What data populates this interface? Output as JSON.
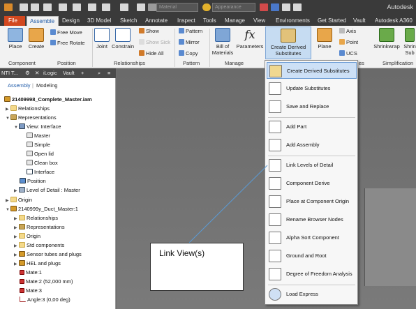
{
  "app": {
    "title": "Autodesk"
  },
  "qat": {
    "material": "Material",
    "appearance": "Appearance"
  },
  "tabs": [
    "File",
    "Assemble",
    "Design",
    "3D Model",
    "Sketch",
    "Annotate",
    "Inspect",
    "Tools",
    "Manage",
    "View",
    "Environments",
    "Get Started",
    "Vault",
    "Autodesk A360"
  ],
  "ribbon": {
    "place": "Place",
    "create": "Create",
    "free_move": "Free Move",
    "free_rotate": "Free Rotate",
    "joint": "Joint",
    "constrain": "Constrain",
    "show": "Show",
    "show_sick": "Show Sick",
    "hide_all": "Hide All",
    "pattern": "Pattern",
    "mirror": "Mirror",
    "copy": "Copy",
    "bom_line1": "Bill of",
    "bom_line2": "Materials",
    "parameters": "Parameters",
    "cds_line1": "Create Derived",
    "cds_line2": "Substitutes",
    "plane": "Plane",
    "axis": "Axis",
    "point": "Point",
    "ucs": "UCS",
    "shrinkwrap": "Shrinkwrap",
    "shrinkwrap_sub_line1": "Shrin",
    "shrinkwrap_sub_line2": "Sub",
    "panels": {
      "component": "Component",
      "position": "Position",
      "relationships": "Relationships",
      "pattern": "Pattern",
      "manage": "Manage",
      "work_features_tail": "es",
      "simplification": "Simplification"
    }
  },
  "browser": {
    "tab_label": "NTI T...",
    "ilogic": "iLogic",
    "vault": "Vault",
    "mode_assembly": "Assembly",
    "mode_modeling": "Modeling",
    "tree": [
      "21409998_Complete_Master.iam",
      "Relationships",
      "Representations",
      "View: Interface",
      "Master",
      "Simple",
      "Open lid",
      "Clean box",
      "Interface",
      "Position",
      "Level of Detail : Master",
      "Origin",
      "2140999y_Duct_Master:1",
      "Relationships",
      "Representations",
      "Origin",
      "Std components",
      "Sensor tubes and plugs",
      "HEL and plugs",
      "Mate:1",
      "Mate:2 (52,000 mm)",
      "Mate:3",
      "Angle:3 (0,00 deg)"
    ]
  },
  "menu": {
    "items": [
      "Create Derived Substitutes",
      "Update Substitutes",
      "Save and Replace",
      "Add Part",
      "Add Assembly",
      "Link Levels of Detail",
      "Component Derive",
      "Place at Component Origin",
      "Rename Browser Nodes",
      "Alpha Sort Component",
      "Ground and Root",
      "Degree of Freedom Analysis",
      "Load Express"
    ]
  },
  "callout": {
    "text": "Link View(s)"
  }
}
